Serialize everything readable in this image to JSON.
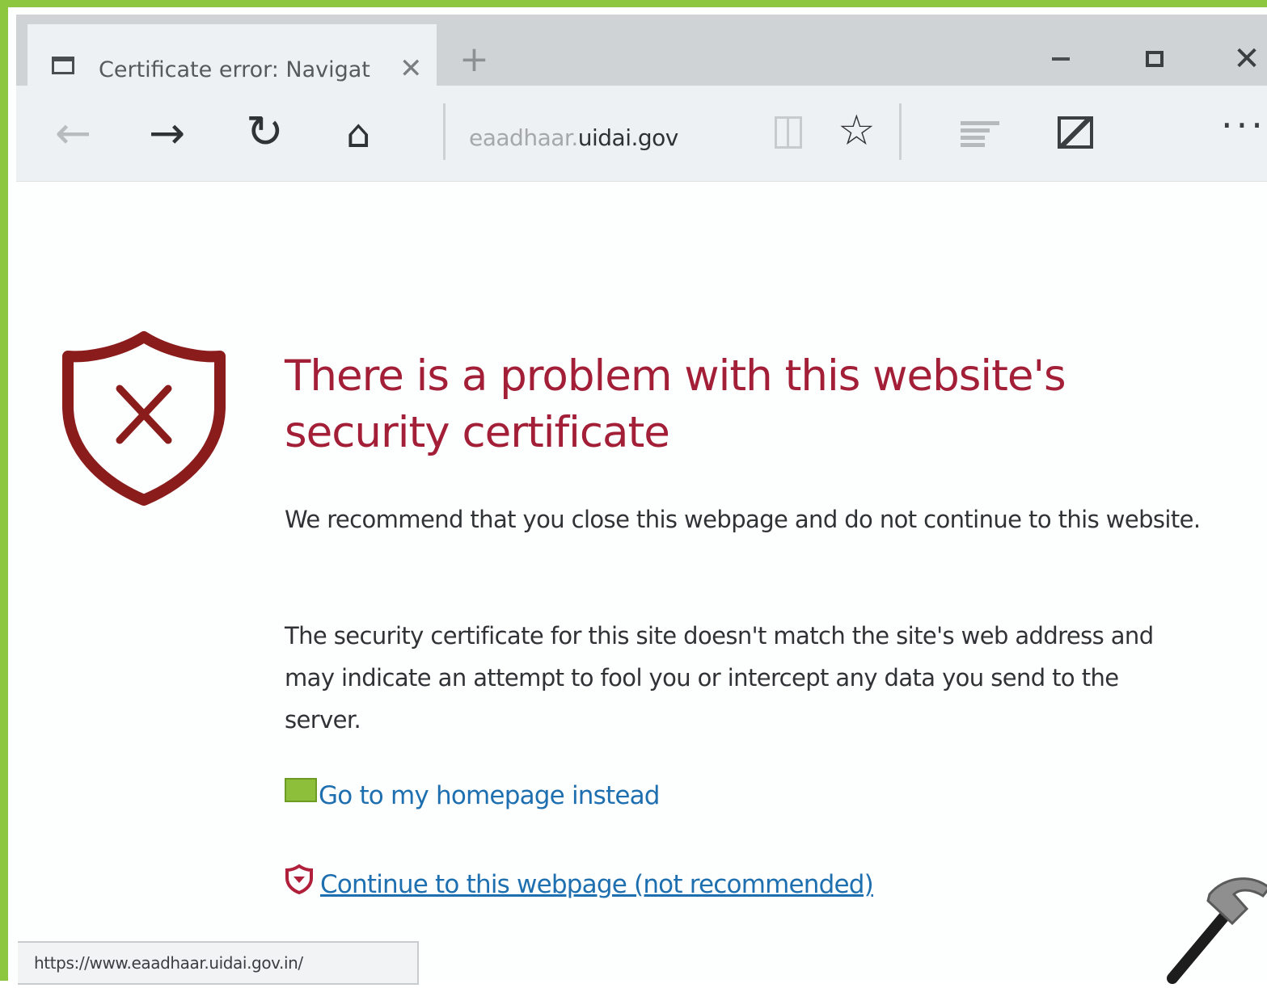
{
  "browser": {
    "tab": {
      "title": "Certificate error: Navigat",
      "close": "✕"
    },
    "new_tab": "+",
    "window_controls": {
      "close": "✕"
    },
    "toolbar": {
      "back": "←",
      "forward": "→",
      "refresh": "↻",
      "home": "⌂",
      "favorite": "☆",
      "more": "···"
    },
    "address": {
      "prefix": "eaadhaar.",
      "domain": "uidai.gov"
    }
  },
  "page": {
    "heading": "There is a problem with this website's security certificate",
    "recommendation": "We recommend that you close this webpage and do not continue to this website.",
    "explanation": "The security certificate for this site doesn't match the site's web address and may indicate an attempt to fool you or intercept any data you send to the server.",
    "home_link": "Go to my homepage instead",
    "continue_link": "Continue to this webpage (not recommended)"
  },
  "status_bar": {
    "url": "https://www.eaadhaar.uidai.gov.in/"
  },
  "colors": {
    "heading": "#a31f37",
    "link": "#1e6fb0",
    "shield": "#8b1c1c",
    "frame_border": "#8dc63f"
  },
  "icons": {
    "tab": "tab-page-icon",
    "shield": "shield-x-icon",
    "home_link": "green-home-icon",
    "continue_link": "red-shield-icon",
    "watermark": "hammer-icon"
  }
}
